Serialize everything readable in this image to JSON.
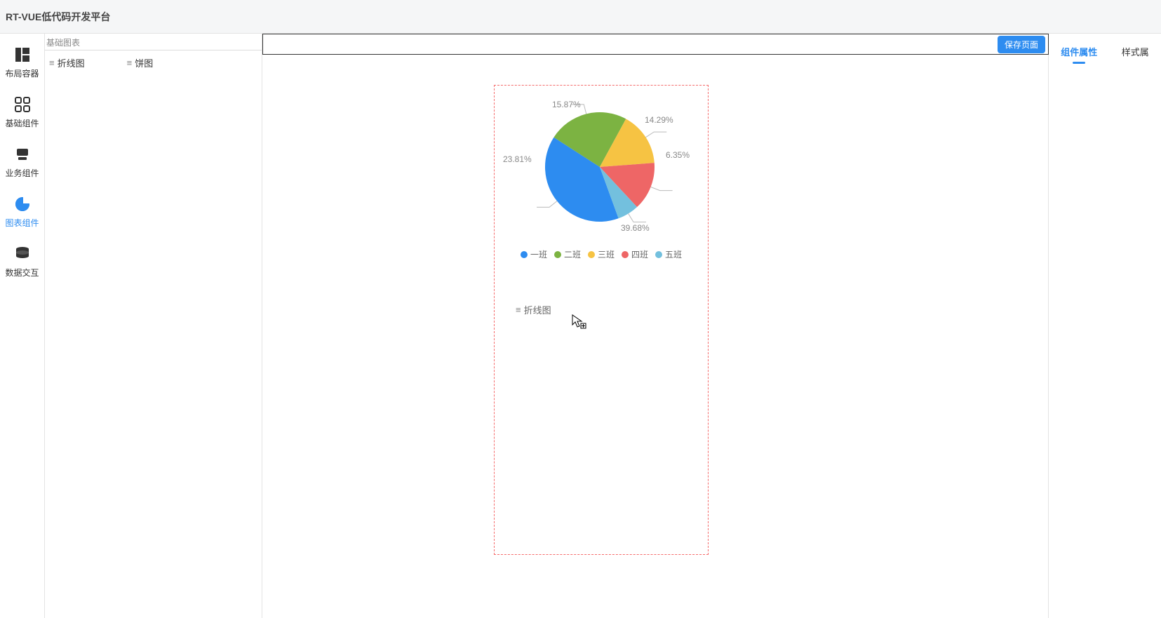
{
  "app": {
    "title": "RT-VUE低代码开发平台"
  },
  "sideNav": {
    "items": [
      {
        "label": "布局容器"
      },
      {
        "label": "基础组件"
      },
      {
        "label": "业务组件"
      },
      {
        "label": "图表组件"
      },
      {
        "label": "数据交互"
      }
    ],
    "activeIndex": 3
  },
  "componentPanel": {
    "group_title": "基础图表",
    "items": [
      {
        "label": "折线图"
      },
      {
        "label": "饼图"
      }
    ]
  },
  "toolbar": {
    "save_label": "保存页面"
  },
  "rightPanel": {
    "tabs": [
      {
        "label": "组件属性"
      },
      {
        "label": "样式属"
      }
    ],
    "activeIndex": 0
  },
  "canvas": {
    "drop_indicator_label": "折线图"
  },
  "chart_data": {
    "type": "pie",
    "series": [
      {
        "name": "一班",
        "value": 39.68,
        "color": "#2d8cf0"
      },
      {
        "name": "二班",
        "value": 23.81,
        "color": "#7cb342"
      },
      {
        "name": "三班",
        "value": 15.87,
        "color": "#f6c343"
      },
      {
        "name": "四班",
        "value": 14.29,
        "color": "#ee6666"
      },
      {
        "name": "五班",
        "value": 6.35,
        "color": "#73c0de"
      }
    ],
    "labels": {
      "s0": "39.68%",
      "s1": "23.81%",
      "s2": "15.87%",
      "s3": "14.29%",
      "s4": "6.35%"
    },
    "legend_position": "bottom"
  }
}
